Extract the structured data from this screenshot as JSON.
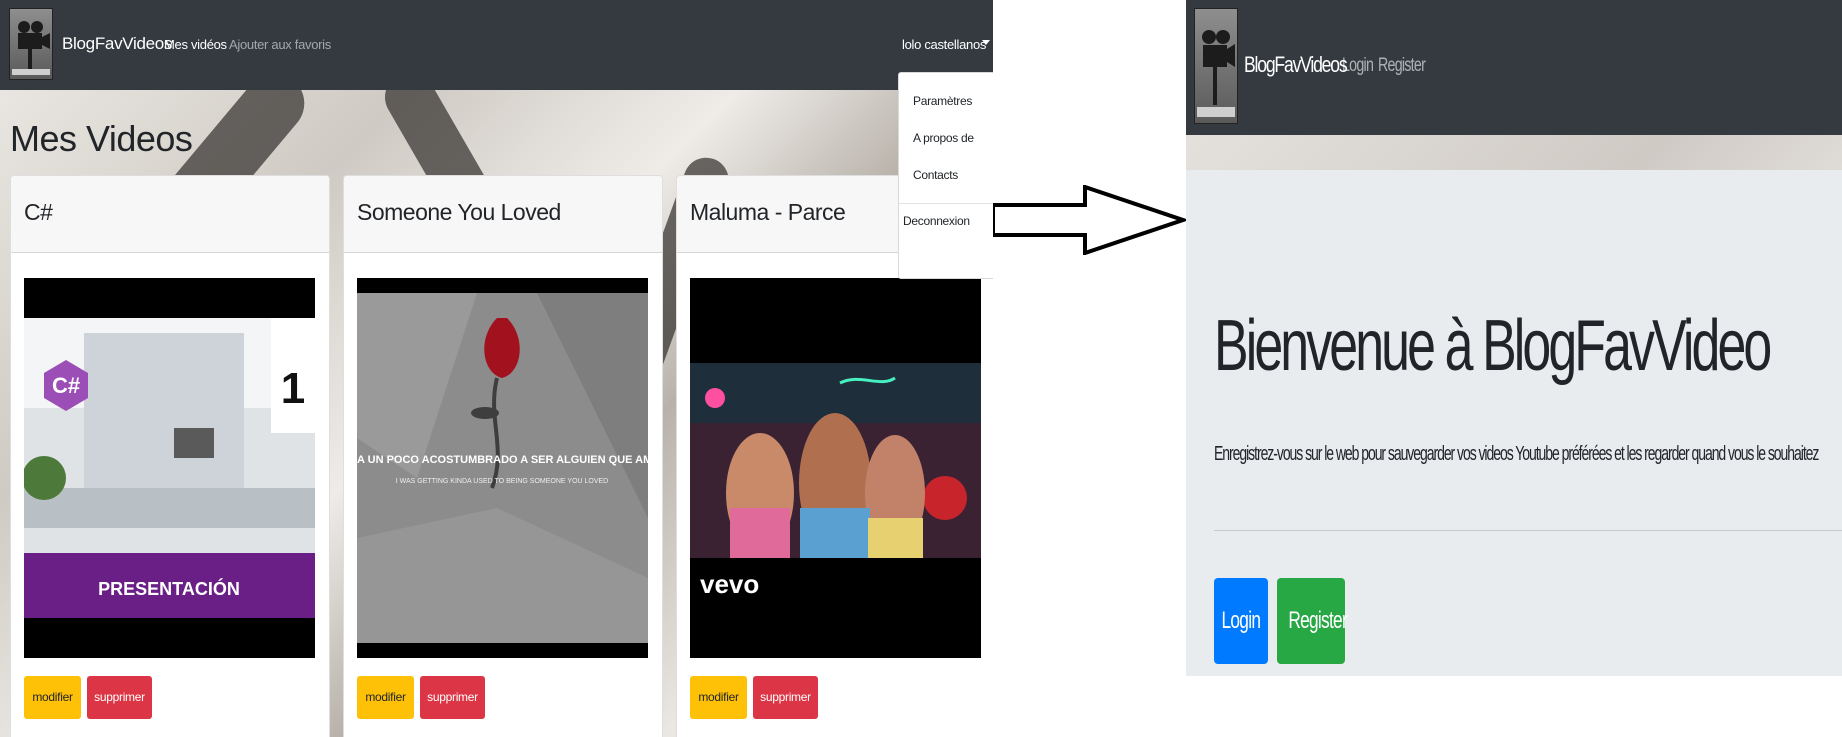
{
  "left_app": {
    "brand": "BlogFavVideos",
    "nav": {
      "my_videos": "Mes vidéos",
      "add_favorites": "Ajouter aux favoris"
    },
    "user": "lolo castellanos",
    "dropdown": {
      "items": [
        "Paramètres",
        "A propos de",
        "Contacts"
      ],
      "logout": "Deconnexion"
    },
    "page_title": "Mes Videos",
    "cards": [
      {
        "title": "C#",
        "thumbnail_icon": "csharp-video-thumbnail",
        "thumbnail_text": "PRESENTACIÓN",
        "thumbnail_number": "1",
        "edit_label": "modifier",
        "delete_label": "supprimer"
      },
      {
        "title": "Someone You Loved",
        "thumbnail_icon": "rose-video-thumbnail",
        "thumbnail_text": "ESTABA UN POCO ACOSTUMBRADO A SER ALGUIEN QUE AMABAS",
        "thumbnail_subtext": "I WAS GETTING KINDA USED TO BEING SOMEONE YOU LOVED",
        "edit_label": "modifier",
        "delete_label": "supprimer"
      },
      {
        "title": "Maluma - Parce",
        "thumbnail_icon": "music-video-thumbnail",
        "thumbnail_text": "vevo",
        "edit_label": "modifier",
        "delete_label": "supprimer"
      }
    ]
  },
  "arrow_icon": "right-arrow-icon",
  "right_app": {
    "brand": "BlogFavVideos",
    "nav": {
      "login": "Login",
      "register": "Register"
    },
    "heading": "Bienvenue à BlogFavVideo",
    "lead": "Enregistrez-vous sur le web pour sauvegarder vos videos Youtube préférées et les regarder quand vous le souhaitez",
    "buttons": {
      "login": "Login",
      "register": "Register"
    }
  },
  "colors": {
    "navbar": "#343a40",
    "warning": "#ffc107",
    "danger": "#dc3545",
    "primary": "#007bff",
    "success": "#28a745",
    "jumbotron": "#e9ecef"
  }
}
